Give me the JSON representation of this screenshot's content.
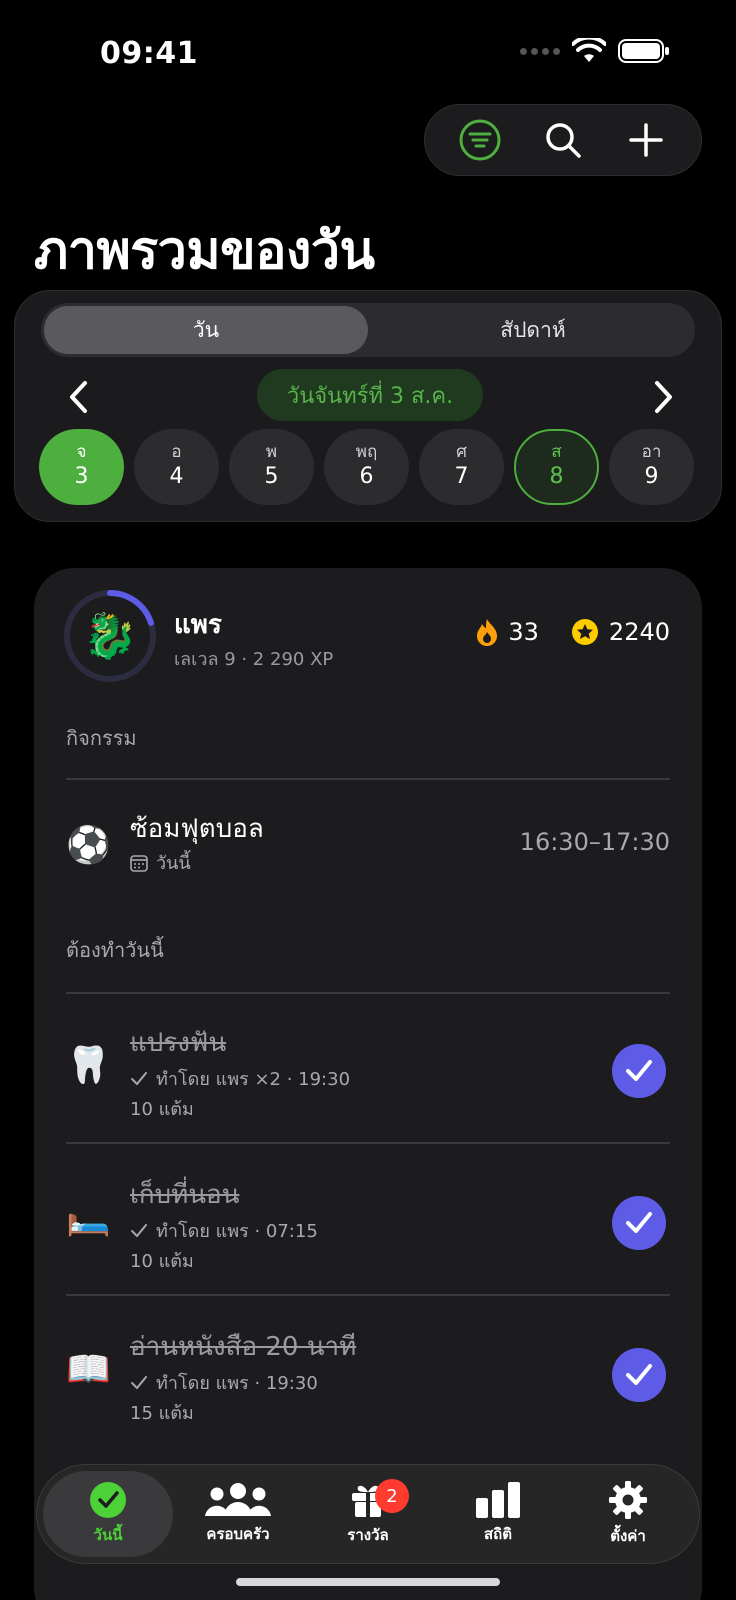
{
  "status_bar": {
    "time": "09:41"
  },
  "toolbar": {
    "icons": [
      "filter-icon",
      "search-icon",
      "plus-icon"
    ]
  },
  "page_title": "ภาพรวมของวัน",
  "date_selector": {
    "segments": [
      {
        "label": "วัน",
        "active": true
      },
      {
        "label": "สัปดาห์",
        "active": false
      }
    ],
    "current_date_label": "วันจันทร์ที่ 3 ส.ค.",
    "days": [
      {
        "name": "จ",
        "num": "3",
        "state": "selected"
      },
      {
        "name": "อ",
        "num": "4",
        "state": ""
      },
      {
        "name": "พ",
        "num": "5",
        "state": ""
      },
      {
        "name": "พฤ",
        "num": "6",
        "state": ""
      },
      {
        "name": "ศ",
        "num": "7",
        "state": ""
      },
      {
        "name": "ส",
        "num": "8",
        "state": "today"
      },
      {
        "name": "อา",
        "num": "9",
        "state": ""
      }
    ]
  },
  "profile": {
    "name": "แพร",
    "level": "เลเวล 9 · 2 290 XP",
    "xp_progress": 0.2,
    "streak": "33",
    "coins": "2240",
    "accent": "#5e5ce6"
  },
  "activities": {
    "section_label": "กิจกรรม",
    "items": [
      {
        "emoji": "⚽",
        "title": "ซ้อมฟุตบอล",
        "sub": "วันนี้",
        "time": "16:30–17:30"
      }
    ]
  },
  "tasks": {
    "section_label": "ต้องทำวันนี้",
    "items": [
      {
        "emoji": "🦷",
        "title": "แปรงฟัน",
        "by": "ทำโดย แพร ×2 · 19:30",
        "points": "10 แต้ม",
        "done": true
      },
      {
        "emoji": "🛏️",
        "title": "เก็บที่นอน",
        "by": "ทำโดย แพร · 07:15",
        "points": "10 แต้ม",
        "done": true
      },
      {
        "emoji": "📖",
        "title": "อ่านหนังสือ 20 นาที",
        "by": "ทำโดย แพร · 19:30",
        "points": "15 แต้ม",
        "done": true
      }
    ]
  },
  "tabbar": {
    "tabs": [
      {
        "label": "วันนี้",
        "icon": "check-circle-icon",
        "active": true
      },
      {
        "label": "ครอบครัว",
        "icon": "people-icon",
        "active": false
      },
      {
        "label": "รางวัล",
        "icon": "gift-icon",
        "active": false,
        "badge": "2"
      },
      {
        "label": "สถิติ",
        "icon": "bar-chart-icon",
        "active": false
      },
      {
        "label": "ตั้งค่า",
        "icon": "gear-icon",
        "active": false
      }
    ]
  },
  "colors": {
    "green": "#4caf3e",
    "purple": "#5e5ce6",
    "badge_red": "#ff3b30"
  }
}
